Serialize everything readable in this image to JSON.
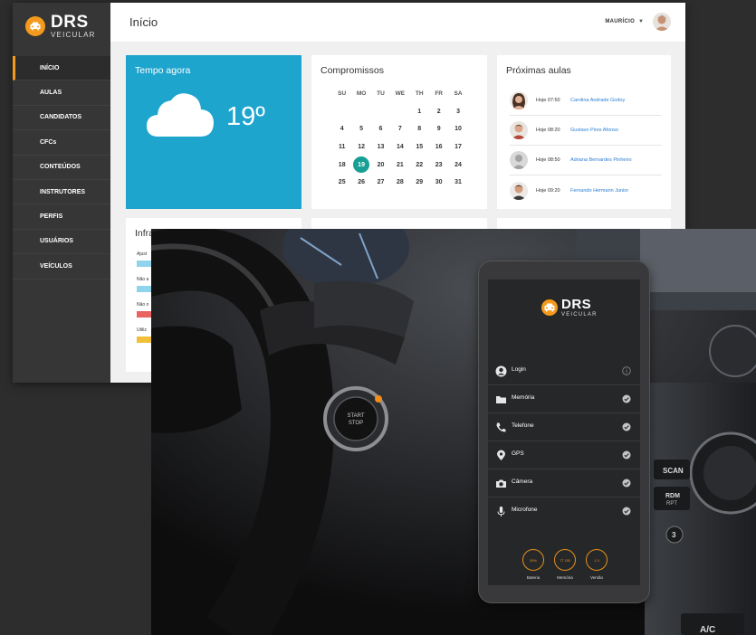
{
  "logo": {
    "main": "DRS",
    "sub": "VEICULAR"
  },
  "sidebar": {
    "items": [
      {
        "label": "INÍCIO",
        "active": true
      },
      {
        "label": "AULAS"
      },
      {
        "label": "CANDIDATOS"
      },
      {
        "label": "CFCs"
      },
      {
        "label": "CONTEÚDOS"
      },
      {
        "label": "INSTRUTORES"
      },
      {
        "label": "PERFIS"
      },
      {
        "label": "USUÁRIOS"
      },
      {
        "label": "VEÍCULOS"
      }
    ]
  },
  "header": {
    "title": "Início",
    "user": "MAURÍCIO"
  },
  "weather": {
    "title": "Tempo agora",
    "temp": "19º",
    "icon": "cloud-icon"
  },
  "calendar": {
    "title": "Compromissos",
    "days": [
      "SU",
      "MO",
      "TU",
      "WE",
      "TH",
      "FR",
      "SA"
    ],
    "cells": [
      "",
      "",
      "",
      "",
      "1",
      "2",
      "3",
      "4",
      "5",
      "6",
      "7",
      "8",
      "9",
      "10",
      "11",
      "12",
      "13",
      "14",
      "15",
      "16",
      "17",
      "18",
      "19",
      "20",
      "21",
      "22",
      "23",
      "24",
      "25",
      "26",
      "27",
      "28",
      "29",
      "30",
      "31"
    ],
    "today": "19"
  },
  "aulas": {
    "title": "Próximas aulas",
    "items": [
      {
        "when": "Hoje 07:50",
        "name": "Carolina Andrade Godoy"
      },
      {
        "when": "Hoje 08:20",
        "name": "Gustavo Pires Afonso"
      },
      {
        "when": "Hoje 08:50",
        "name": "Adriana Bernardes Pinheiro"
      },
      {
        "when": "Hoje 09:20",
        "name": "Fernando Hermann Junior"
      }
    ]
  },
  "infra": {
    "title": "Infra",
    "labels": [
      "Ajust",
      "Não a",
      "Não o",
      "Utiliz"
    ],
    "colors": [
      "#8fd4ec",
      "#8fd4ec",
      "#e96360",
      "#f2bf3a"
    ]
  },
  "phone": {
    "logo": {
      "main": "DRS",
      "sub": "VEICULAR"
    },
    "rows": [
      {
        "label": "Login",
        "icon": "user-icon",
        "status": "info"
      },
      {
        "label": "Memória",
        "icon": "folder-icon",
        "status": "ok"
      },
      {
        "label": "Telefone",
        "icon": "phone-icon",
        "status": "ok"
      },
      {
        "label": "GPS",
        "icon": "location-pin-icon",
        "status": "ok"
      },
      {
        "label": "Câmera",
        "icon": "camera-icon",
        "status": "ok"
      },
      {
        "label": "Microfone",
        "icon": "microphone-icon",
        "status": "ok"
      }
    ],
    "stats": [
      {
        "value": "39%",
        "label": "Bateria"
      },
      {
        "value": "77 GB",
        "label": "Memória"
      },
      {
        "value": "1.3",
        "label": "Versão"
      }
    ]
  },
  "car_labels": {
    "scan": "SCAN",
    "rdm": "RDM",
    "rpt": "RPT",
    "three": "3",
    "ac": "A/C",
    "start": "START",
    "stop": "STOP"
  },
  "colors": {
    "accent": "#f49a1c",
    "weather": "#1ea5ce",
    "today": "#169f95",
    "sidebar": "#363636"
  }
}
